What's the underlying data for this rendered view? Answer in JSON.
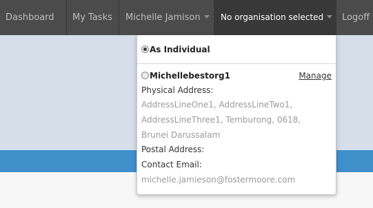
{
  "nav": {
    "items": [
      {
        "label": "Dashboard"
      },
      {
        "label": "My Tasks"
      },
      {
        "label": "Michelle Jamison"
      },
      {
        "label": "No organisation selected"
      },
      {
        "label": "Logoff"
      }
    ]
  },
  "dropdown": {
    "individual_label": "As Individual",
    "org": {
      "name": "Michellebestorg1",
      "manage_label": "Manage",
      "physical_address_label": "Physical Address:",
      "physical_address_lines": [
        "AddressLineOne1, AddressLineTwo1,",
        "AddressLineThree1, Temburong, 0618,",
        "Brunei Darussalam"
      ],
      "postal_address_label": "Postal Address:",
      "contact_email_label": "Contact Email:",
      "contact_email": "michelle.jamieson@fostermoore.com"
    },
    "selected": "As Individual"
  },
  "colors": {
    "navbar": "#4b4b4b",
    "hero": "#d6deea",
    "accent_bar": "#3f8fcb"
  }
}
